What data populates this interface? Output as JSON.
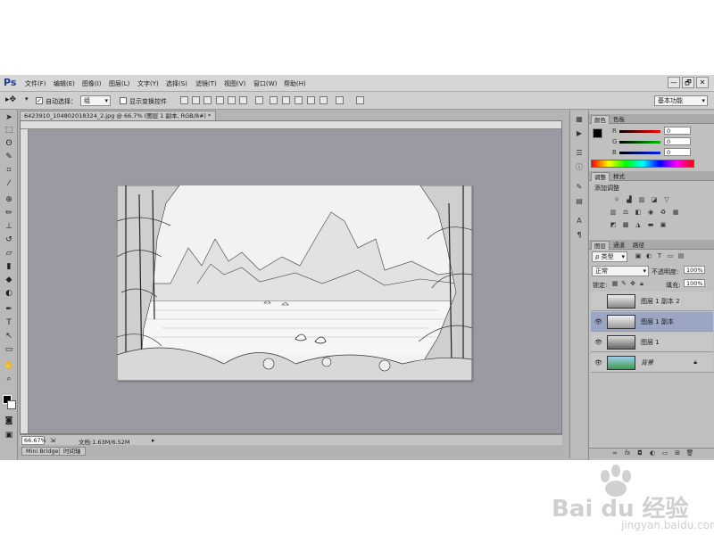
{
  "app": {
    "logo": "Ps",
    "menu": [
      "文件(F)",
      "编辑(E)",
      "图像(I)",
      "图层(L)",
      "文字(Y)",
      "选择(S)",
      "滤镜(T)",
      "视图(V)",
      "窗口(W)",
      "帮助(H)"
    ],
    "window_controls": [
      "—",
      "🗗",
      "✕"
    ]
  },
  "options": {
    "auto_select_label": "自动选择：",
    "auto_select_value": "组",
    "show_transform_label": "显示变换控件",
    "workspace": "基本功能"
  },
  "document": {
    "tab_title": "6423910_104802018324_2.jpg @ 66.7% (图层 1 副本, RGB/8#) *",
    "zoom": "66.67%",
    "doc_info": "文档:1.63M/6.52M"
  },
  "bottom_tabs": [
    "Mini Bridge",
    "时间轴"
  ],
  "color_panel": {
    "tabs": [
      "颜色",
      "色板"
    ],
    "channels": [
      {
        "label": "R",
        "value": "0",
        "color": "#d02020"
      },
      {
        "label": "G",
        "value": "0",
        "color": "#20a020"
      },
      {
        "label": "B",
        "value": "0",
        "color": "#2030c0"
      }
    ]
  },
  "adjust_panel": {
    "tabs": [
      "调整",
      "样式"
    ],
    "title": "添加调整"
  },
  "layers_panel": {
    "tabs": [
      "图层",
      "通道",
      "路径"
    ],
    "kind_label": "ρ 类型",
    "blend_mode": "正常",
    "opacity_label": "不透明度:",
    "opacity_value": "100%",
    "lock_label": "锁定:",
    "fill_label": "填充:",
    "fill_value": "100%",
    "layers": [
      {
        "name": "图层 1 副本 2",
        "visible": false,
        "selected": false,
        "thumb": "sketch"
      },
      {
        "name": "图层 1 副本",
        "visible": true,
        "selected": true,
        "thumb": "sketch"
      },
      {
        "name": "图层 1",
        "visible": true,
        "selected": false,
        "thumb": "sketch"
      },
      {
        "name": "背景",
        "visible": true,
        "selected": false,
        "thumb": "color",
        "locked": true
      }
    ],
    "footer_icons": [
      "link-icon",
      "fx-icon",
      "mask-icon",
      "adjustment-icon",
      "group-icon",
      "new-layer-icon",
      "trash-icon"
    ]
  },
  "watermark": {
    "brand": "Bai du 经验",
    "url": "jingyan.baidu.com"
  }
}
